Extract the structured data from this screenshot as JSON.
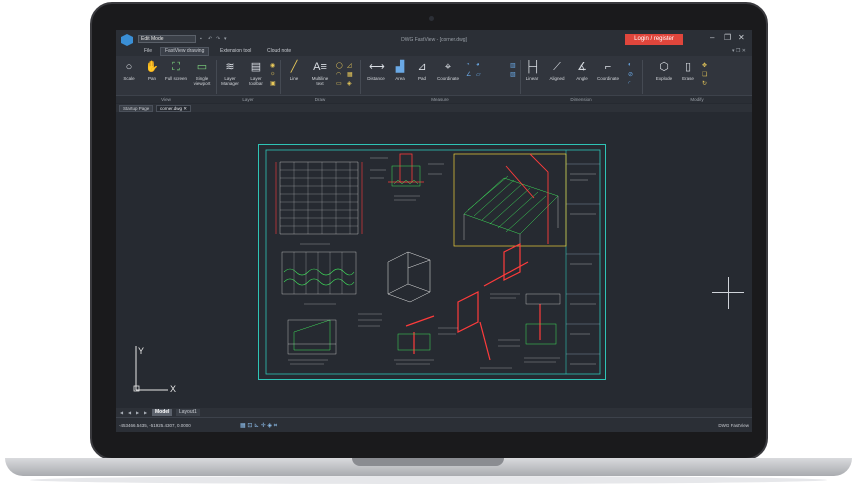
{
  "window": {
    "title": "DWG FastView - [corner.dwg]",
    "mode_select": "Edit Mode",
    "login_button": "Login / register"
  },
  "menu": [
    {
      "label": "File",
      "active": false
    },
    {
      "label": "FastView drawing",
      "active": true
    },
    {
      "label": "Extension tool",
      "active": false
    },
    {
      "label": "Cloud note",
      "active": false
    }
  ],
  "ribbon": {
    "tools": [
      {
        "label": "Scale",
        "icon": "magnifier-icon"
      },
      {
        "label": "Pan",
        "icon": "hand-icon"
      },
      {
        "label": "Full screen",
        "icon": "fullscreen-icon"
      },
      {
        "label": "Single viewport",
        "icon": "viewport-icon"
      },
      {
        "label": "Layer Manager",
        "icon": "layers-icon"
      },
      {
        "label": "Layer toolbar",
        "icon": "layer-toolbar-icon"
      },
      {
        "label": "Line",
        "icon": "line-icon"
      },
      {
        "label": "Multiline text",
        "icon": "mtext-icon"
      },
      {
        "label": "Distance",
        "icon": "distance-icon"
      },
      {
        "label": "Area",
        "icon": "area-icon"
      },
      {
        "label": "Pad",
        "icon": "pad-icon"
      },
      {
        "label": "Coordinate",
        "icon": "coordinate-icon"
      },
      {
        "label": "Linear",
        "icon": "linear-dim-icon"
      },
      {
        "label": "Aligned",
        "icon": "aligned-dim-icon"
      },
      {
        "label": "Angle",
        "icon": "angle-dim-icon"
      },
      {
        "label": "Coordinate",
        "icon": "coordinate-dim-icon"
      },
      {
        "label": "Explode",
        "icon": "explode-icon"
      },
      {
        "label": "Erase",
        "icon": "erase-icon"
      }
    ],
    "groups": [
      "View",
      "Layer",
      "Draw",
      "Measure",
      "Dimension",
      "Modify"
    ]
  },
  "doc_tabs": [
    {
      "label": "Startup Page",
      "active": false
    },
    {
      "label": "corner.dwg",
      "active": true
    }
  ],
  "layout_tabs": [
    {
      "label": "Model",
      "active": true
    },
    {
      "label": "Layout1",
      "active": false
    }
  ],
  "status": {
    "coordinates": "-453466.5435, -51925.4307, 0.0000",
    "app_name": "DWG FastView"
  },
  "ucs": {
    "x_label": "X",
    "y_label": "Y"
  },
  "colors": {
    "accent": "#e0463c",
    "canvas": "#262a31",
    "drawing_frame": "#2ec4b6"
  }
}
